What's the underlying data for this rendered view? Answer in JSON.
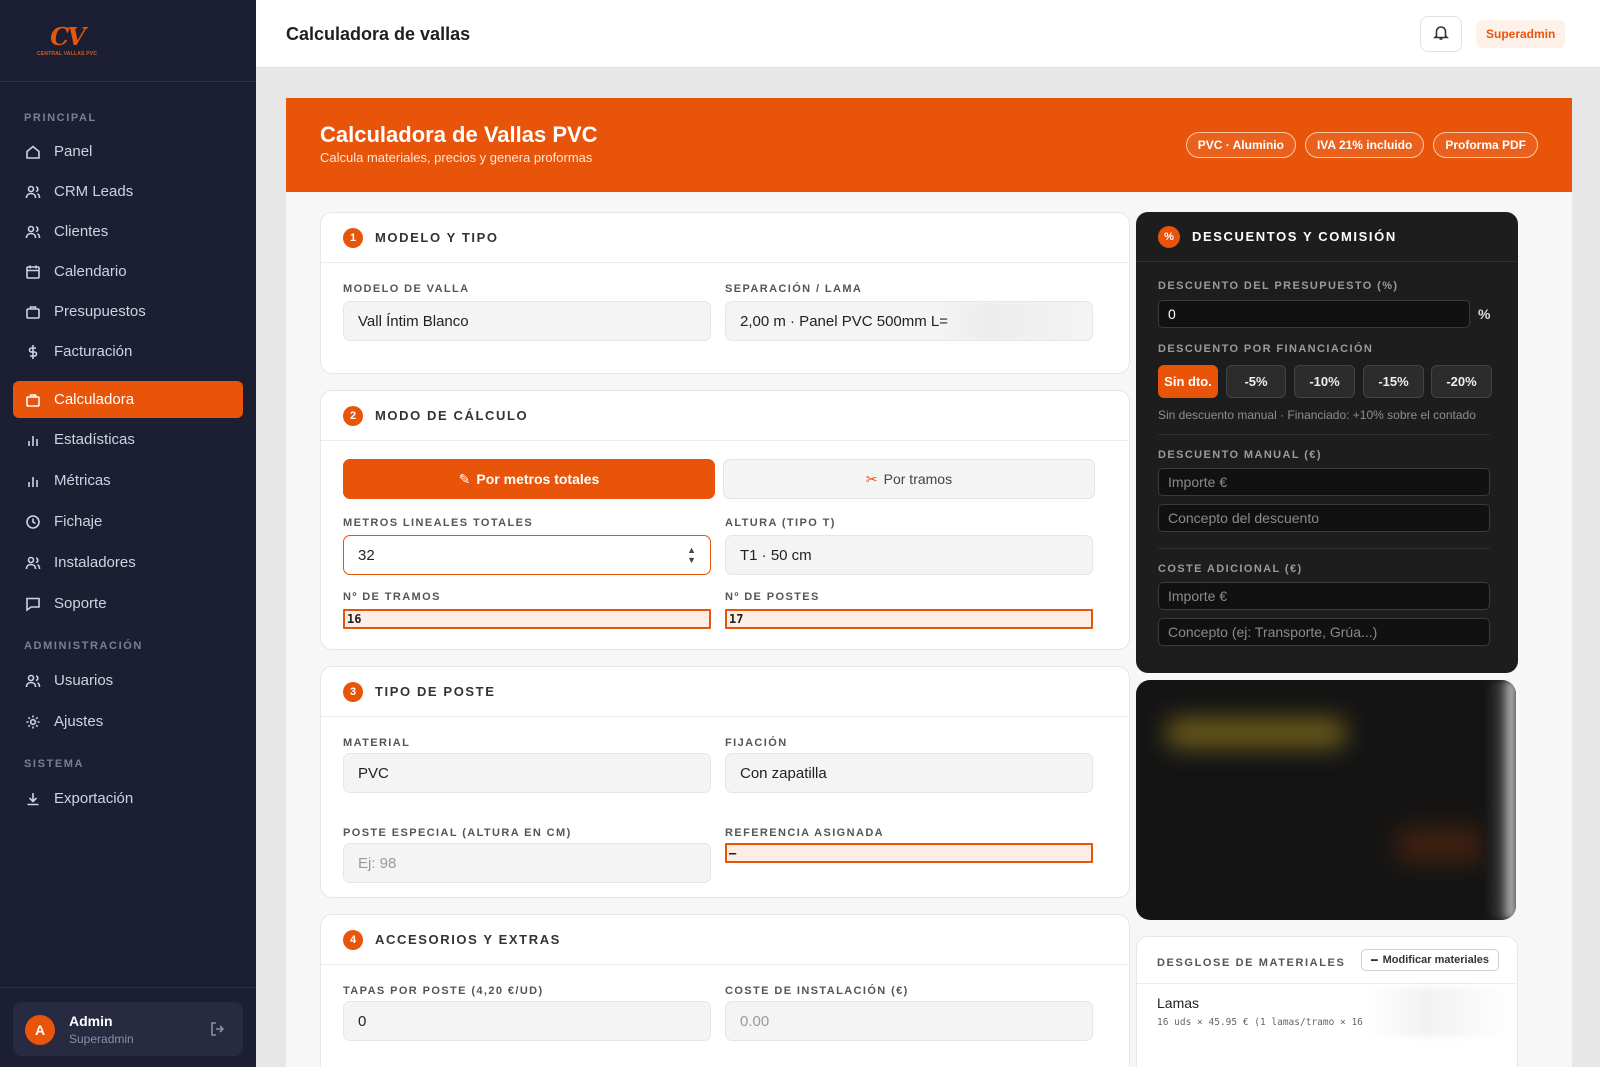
{
  "brand": {
    "logo_text": "CV",
    "logo_sub": "CENTRAL VALLAS PVC"
  },
  "sidebar": {
    "sections": [
      "PRINCIPAL",
      "ADMINISTRACIÓN",
      "SISTEMA"
    ],
    "items": [
      {
        "label": "Panel",
        "icon": "home-icon"
      },
      {
        "label": "CRM Leads",
        "icon": "users-icon"
      },
      {
        "label": "Clientes",
        "icon": "users-icon"
      },
      {
        "label": "Calendario",
        "icon": "calendar-icon"
      },
      {
        "label": "Presupuestos",
        "icon": "briefcase-icon"
      },
      {
        "label": "Facturación",
        "icon": "dollar-icon"
      },
      {
        "label": "Calculadora",
        "icon": "calculator-icon",
        "active": true
      },
      {
        "label": "Estadísticas",
        "icon": "bar-chart-icon"
      },
      {
        "label": "Métricas",
        "icon": "bar-chart-icon"
      },
      {
        "label": "Fichaje",
        "icon": "clock-icon"
      },
      {
        "label": "Instaladores",
        "icon": "users-icon"
      },
      {
        "label": "Soporte",
        "icon": "message-icon"
      },
      {
        "label": "Usuarios",
        "icon": "users-icon"
      },
      {
        "label": "Ajustes",
        "icon": "gear-icon"
      },
      {
        "label": "Exportación",
        "icon": "download-icon"
      }
    ],
    "user": {
      "initial": "A",
      "name": "Admin",
      "role": "Superadmin"
    }
  },
  "topbar": {
    "title": "Calculadora de vallas",
    "role_badge": "Superadmin"
  },
  "banner": {
    "title": "Calculadora de Vallas PVC",
    "subtitle": "Calcula materiales, precios y genera proformas",
    "tags": [
      "PVC · Aluminio",
      "IVA 21% incluido",
      "Proforma PDF"
    ]
  },
  "section1": {
    "num": "1",
    "title": "MODELO Y TIPO",
    "model_label": "MODELO DE VALLA",
    "model_value": "Vall Íntim Blanco",
    "sep_label": "SEPARACIÓN / LAMA",
    "sep_value": "2,00 m · Panel PVC 500mm L="
  },
  "section2": {
    "num": "2",
    "title": "MODO DE CÁLCULO",
    "mode_total": "Por metros totales",
    "mode_tramos": "Por tramos",
    "metros_label": "METROS LINEALES TOTALES",
    "metros_value": "32",
    "altura_label": "ALTURA (TIPO T)",
    "altura_value": "T1 · 50 cm",
    "tramos_label": "Nº DE TRAMOS",
    "tramos_value": "16",
    "postes_label": "Nº DE POSTES",
    "postes_value": "17"
  },
  "section3": {
    "num": "3",
    "title": "TIPO DE POSTE",
    "material_label": "MATERIAL",
    "material_value": "PVC",
    "fijacion_label": "FIJACIÓN",
    "fijacion_value": "Con zapatilla",
    "especial_label": "POSTE ESPECIAL (ALTURA EN CM)",
    "especial_placeholder": "Ej: 98",
    "ref_label": "REFERENCIA ASIGNADA",
    "ref_value": "–"
  },
  "section4": {
    "num": "4",
    "title": "ACCESORIOS Y EXTRAS",
    "tapas_label": "TAPAS POR POSTE (4,20 €/UD)",
    "tapas_value": "0",
    "inst_label": "COSTE DE INSTALACIÓN (€)",
    "inst_placeholder": "0.00"
  },
  "discounts": {
    "badge": "%",
    "title": "DESCUENTOS Y COMISIÓN",
    "budget_label": "DESCUENTO DEL PRESUPUESTO (%)",
    "budget_value": "0",
    "budget_unit": "%",
    "fin_label": "DESCUENTO POR FINANCIACIÓN",
    "fin_options": [
      "Sin dto.",
      "-5%",
      "-10%",
      "-15%",
      "-20%"
    ],
    "fin_note": "Sin descuento manual · Financiado: +10% sobre el contado",
    "manual_label": "DESCUENTO MANUAL (€)",
    "manual_amount_ph": "Importe €",
    "manual_concept_ph": "Concepto del descuento",
    "extra_label": "COSTE ADICIONAL (€)",
    "extra_amount_ph": "Importe €",
    "extra_concept_ph": "Concepto (ej: Transporte, Grúa...)"
  },
  "materials": {
    "title": "DESGLOSE DE MATERIALES",
    "modify_btn": "Modificar materiales",
    "item_name": "Lamas",
    "item_detail": "16 uds × 45.95 € (1 lamas/tramo × 16"
  },
  "colors": {
    "accent": "#e8540a",
    "sidebar": "#1c1f33",
    "dark_panel": "#1d1d1d"
  }
}
